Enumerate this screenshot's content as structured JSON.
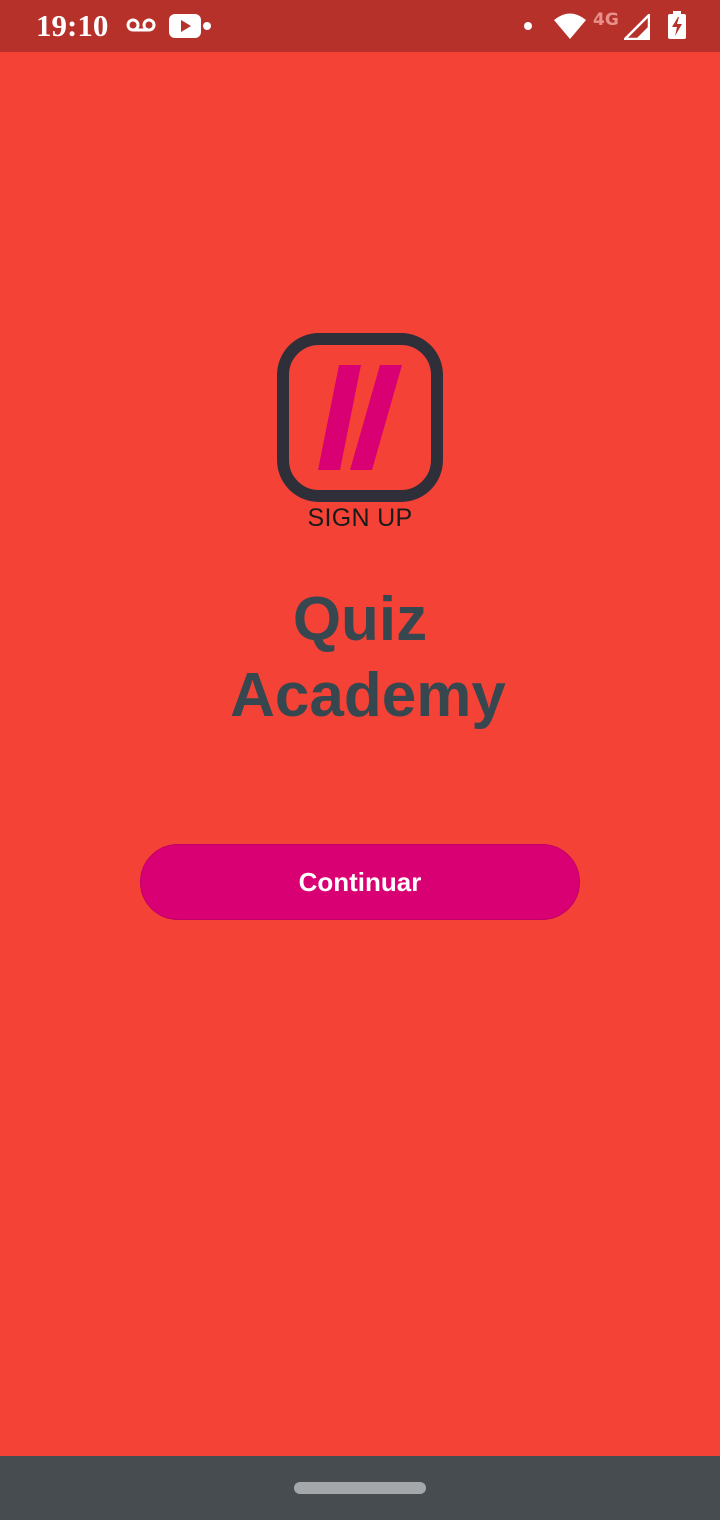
{
  "status_bar": {
    "time": "19:10",
    "network_type": "4G",
    "icons": [
      "voicemail-icon",
      "youtube-icon",
      "notification-dot-icon",
      "dot-icon",
      "wifi-icon",
      "cell-signal-icon",
      "battery-charging-icon"
    ]
  },
  "logo": {
    "icon": "double-slash-logo-icon",
    "caption": "SIGN UP"
  },
  "title": {
    "line1": "Quiz",
    "line2": "Academy"
  },
  "continue_button": {
    "label": "Continuar"
  },
  "colors": {
    "background": "#f44336",
    "status_bar": "#b7312b",
    "accent": "#d80073",
    "title_text": "#37474f",
    "nav_bar": "#474c51"
  }
}
